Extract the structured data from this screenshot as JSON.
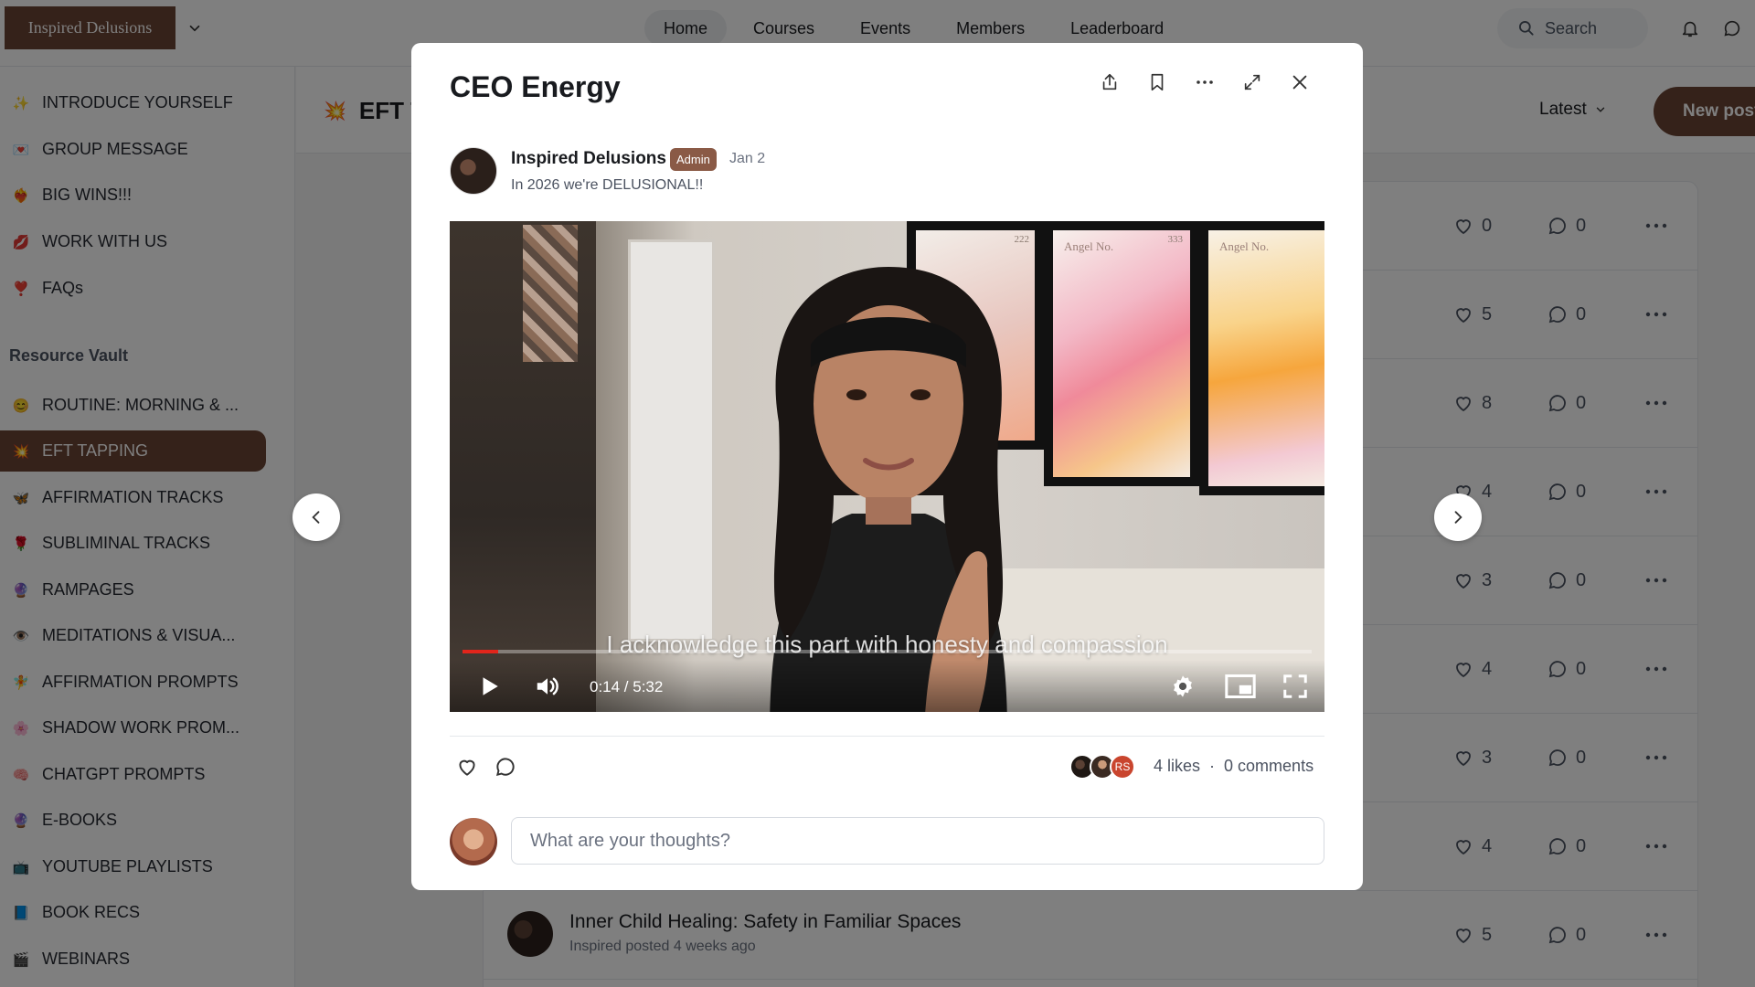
{
  "app": {
    "brand": "Inspired Delusions"
  },
  "nav": {
    "items": [
      "Home",
      "Courses",
      "Events",
      "Members",
      "Leaderboard"
    ],
    "active": "Home"
  },
  "search": {
    "label": "Search"
  },
  "sidebar": {
    "top_items": [
      {
        "emoji": "✨",
        "label": "INTRODUCE YOURSELF"
      },
      {
        "emoji": "💌",
        "label": "GROUP MESSAGE"
      },
      {
        "emoji": "❤️‍🔥",
        "label": "BIG WINS!!!"
      },
      {
        "emoji": "💋",
        "label": "WORK WITH US"
      },
      {
        "emoji": "❣️",
        "label": "FAQs"
      }
    ],
    "section_header": "Resource Vault",
    "vault_items": [
      {
        "emoji": "😊",
        "label": "ROUTINE: MORNING & ..."
      },
      {
        "emoji": "💥",
        "label": "EFT TAPPING"
      },
      {
        "emoji": "🦋",
        "label": "AFFIRMATION TRACKS"
      },
      {
        "emoji": "🌹",
        "label": "SUBLIMINAL TRACKS"
      },
      {
        "emoji": "🔮",
        "label": "RAMPAGES"
      },
      {
        "emoji": "👁️",
        "label": "MEDITATIONS & VISUA..."
      },
      {
        "emoji": "🧚",
        "label": "AFFIRMATION PROMPTS"
      },
      {
        "emoji": "🌸",
        "label": "SHADOW WORK PROM..."
      },
      {
        "emoji": "🧠",
        "label": "CHATGPT PROMPTS"
      },
      {
        "emoji": "🔮",
        "label": "E-BOOKS"
      },
      {
        "emoji": "📺",
        "label": "YOUTUBE PLAYLISTS"
      },
      {
        "emoji": "📘",
        "label": "BOOK RECS"
      },
      {
        "emoji": "🎬",
        "label": "WEBINARS"
      }
    ],
    "active_label": "EFT TAPPING"
  },
  "feed": {
    "title_emoji": "💥",
    "title": "EFT TAPPING",
    "sort_label": "Latest",
    "new_post_label": "New post",
    "rows": [
      {
        "likes": "0",
        "comments": "0"
      },
      {
        "likes": "5",
        "comments": "0"
      },
      {
        "likes": "8",
        "comments": "0"
      },
      {
        "likes": "4",
        "comments": "0"
      },
      {
        "likes": "3",
        "comments": "0"
      },
      {
        "likes": "4",
        "comments": "0"
      },
      {
        "likes": "3",
        "comments": "0"
      },
      {
        "likes": "4",
        "comments": "0"
      },
      {
        "likes": "5",
        "comments": "0",
        "title": "Inner Child Healing: Safety in Familiar Spaces",
        "subtitle": "Inspired posted 4 weeks ago"
      }
    ]
  },
  "modal": {
    "title": "CEO Energy",
    "author": "Inspired Delusions",
    "badge": "Admin",
    "date": "Jan 2",
    "body": "In 2026 we're DELUSIONAL!!",
    "video": {
      "caption": "I acknowledge this part with honesty and compassion",
      "time": "0:14 / 5:32",
      "progress": 0.042,
      "art_labels": [
        "222",
        "Angel No.",
        "333",
        "Angel No."
      ]
    },
    "likers": [
      "",
      "",
      "RS"
    ],
    "likes_text": "4 likes",
    "separator": "·",
    "comments_text": "0 comments",
    "comment_placeholder": "What are your thoughts?"
  }
}
